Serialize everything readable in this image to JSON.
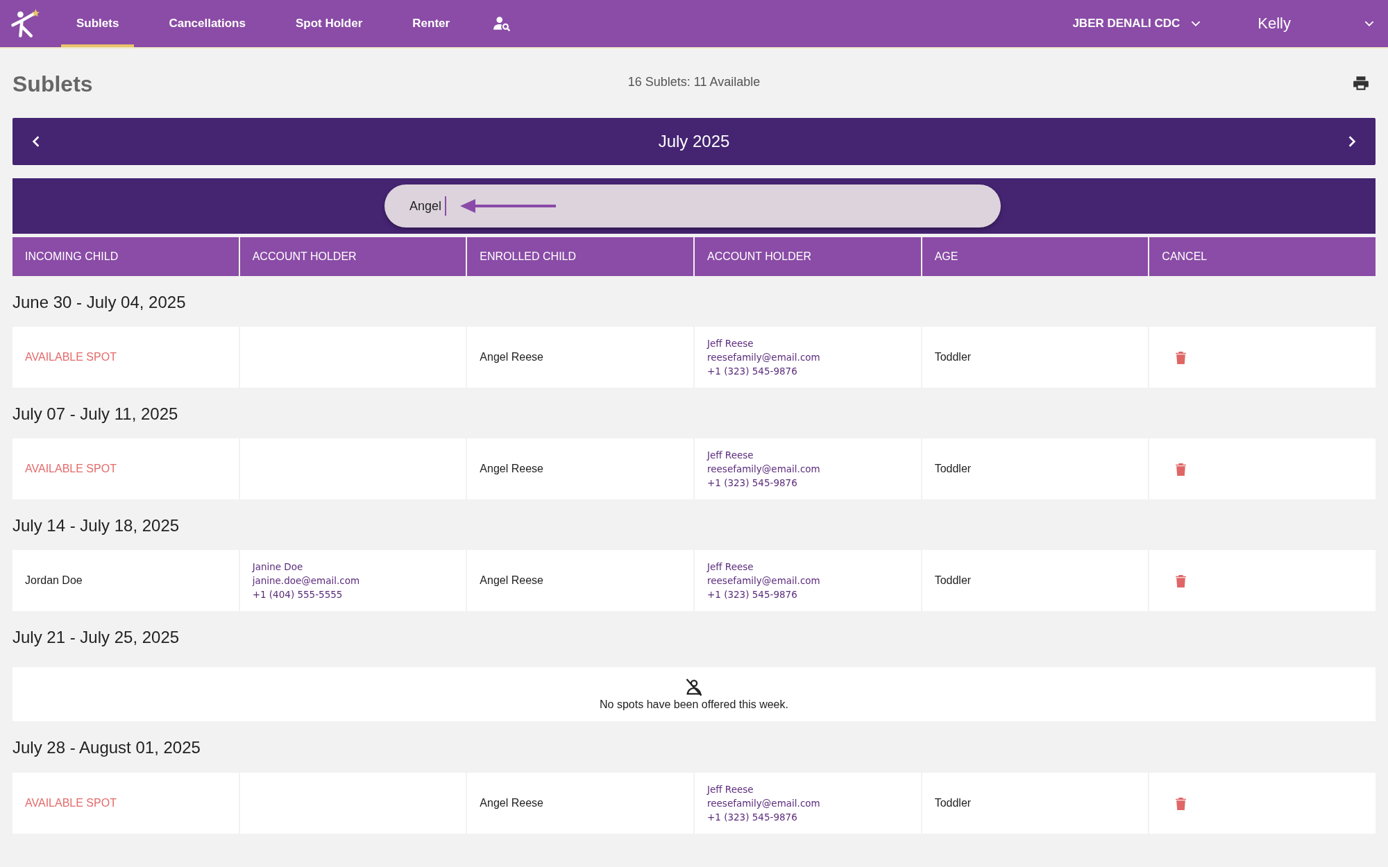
{
  "nav": {
    "tabs": [
      {
        "label": "Sublets",
        "selected": true
      },
      {
        "label": "Cancellations",
        "selected": false
      },
      {
        "label": "Spot Holder",
        "selected": false
      },
      {
        "label": "Renter",
        "selected": false
      }
    ],
    "center": "JBER DENALI CDC",
    "user": "Kelly"
  },
  "page": {
    "title": "Sublets",
    "summary": "16 Sublets: 11 Available"
  },
  "month": "July 2025",
  "search": {
    "value": "Angel"
  },
  "columns": [
    "INCOMING CHILD",
    "ACCOUNT HOLDER",
    "ENROLLED CHILD",
    "ACCOUNT HOLDER",
    "AGE",
    "CANCEL"
  ],
  "weeks": [
    {
      "label": "June 30 - July 04, 2025",
      "kind": "rows",
      "rows": [
        {
          "incoming": {
            "kind": "available",
            "text": "AVAILABLE SPOT"
          },
          "incoming_holder": [],
          "enrolled": "Angel Reese",
          "holder": [
            "Jeff Reese",
            "reesefamily@email.com",
            "+1 (323) 545-9876"
          ],
          "age": "Toddler"
        }
      ]
    },
    {
      "label": "July 07 - July 11, 2025",
      "kind": "rows",
      "rows": [
        {
          "incoming": {
            "kind": "available",
            "text": "AVAILABLE SPOT"
          },
          "incoming_holder": [],
          "enrolled": "Angel Reese",
          "holder": [
            "Jeff Reese",
            "reesefamily@email.com",
            "+1 (323) 545-9876"
          ],
          "age": "Toddler"
        }
      ]
    },
    {
      "label": "July 14 - July 18, 2025",
      "kind": "rows",
      "rows": [
        {
          "incoming": {
            "kind": "child",
            "text": "Jordan Doe"
          },
          "incoming_holder": [
            "Janine Doe",
            "janine.doe@email.com",
            "+1 (404) 555-5555"
          ],
          "enrolled": "Angel Reese",
          "holder": [
            "Jeff Reese",
            "reesefamily@email.com",
            "+1 (323) 545-9876"
          ],
          "age": "Toddler"
        }
      ]
    },
    {
      "label": "July 21 - July 25, 2025",
      "kind": "empty",
      "message": "No spots have been offered this week."
    },
    {
      "label": "July 28 - August 01, 2025",
      "kind": "rows",
      "rows": [
        {
          "incoming": {
            "kind": "available",
            "text": "AVAILABLE SPOT"
          },
          "incoming_holder": [],
          "enrolled": "Angel Reese",
          "holder": [
            "Jeff Reese",
            "reesefamily@email.com",
            "+1 (323) 545-9876"
          ],
          "age": "Toddler"
        }
      ]
    }
  ]
}
